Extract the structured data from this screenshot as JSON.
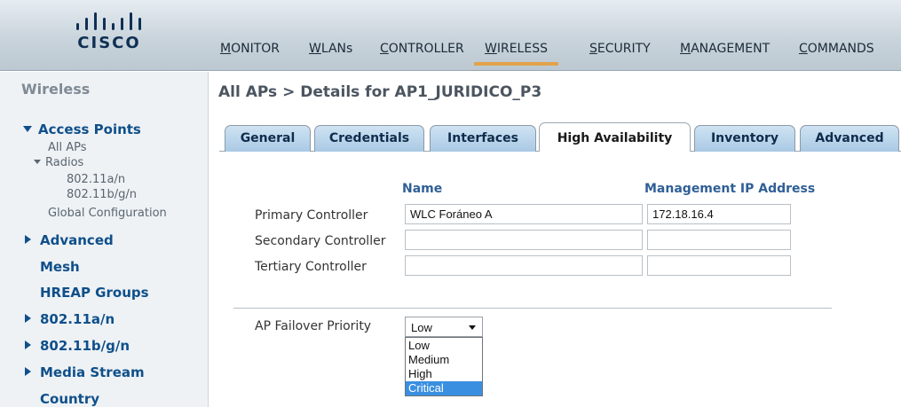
{
  "logo": {
    "word": "CISCO"
  },
  "nav": [
    {
      "first": "M",
      "rest": "ONITOR"
    },
    {
      "first": "W",
      "rest": "LANs"
    },
    {
      "first": "C",
      "rest": "ONTROLLER"
    },
    {
      "first": "W",
      "rest": "IRELESS"
    },
    {
      "first": "S",
      "rest": "ECURITY"
    },
    {
      "first": "M",
      "rest": "ANAGEMENT"
    },
    {
      "first": "C",
      "rest": "OMMANDS"
    }
  ],
  "sidebar": {
    "title": "Wireless",
    "access_points": "Access Points",
    "all_aps": "All APs",
    "radios": "Radios",
    "radio_a": "802.11a/n",
    "radio_bg": "802.11b/g/n",
    "global_config": "Global Configuration",
    "advanced": "Advanced",
    "mesh": "Mesh",
    "hreap": "HREAP Groups",
    "s_80211an": "802.11a/n",
    "s_80211bgn": "802.11b/g/n",
    "media_stream": "Media Stream",
    "country": "Country"
  },
  "page": {
    "title": "All APs > Details for AP1_JURIDICO_P3"
  },
  "tabs": [
    "General",
    "Credentials",
    "Interfaces",
    "High Availability",
    "Inventory",
    "Advanced"
  ],
  "ha": {
    "name_header": "Name",
    "ip_header": "Management IP Address",
    "primary_label": "Primary Controller",
    "secondary_label": "Secondary Controller",
    "tertiary_label": "Tertiary Controller",
    "primary_name": "WLC Foráneo A",
    "primary_ip": "172.18.16.4",
    "secondary_name": "",
    "secondary_ip": "",
    "tertiary_name": "",
    "tertiary_ip": "",
    "failover_label": "AP Failover Priority",
    "failover_value": "Low",
    "options": [
      "Low",
      "Medium",
      "High",
      "Critical"
    ]
  },
  "colors": {
    "accent_underline": "#e2a24a",
    "link_blue": "#0f4f8a",
    "selected_option": "#3a8fe0"
  }
}
